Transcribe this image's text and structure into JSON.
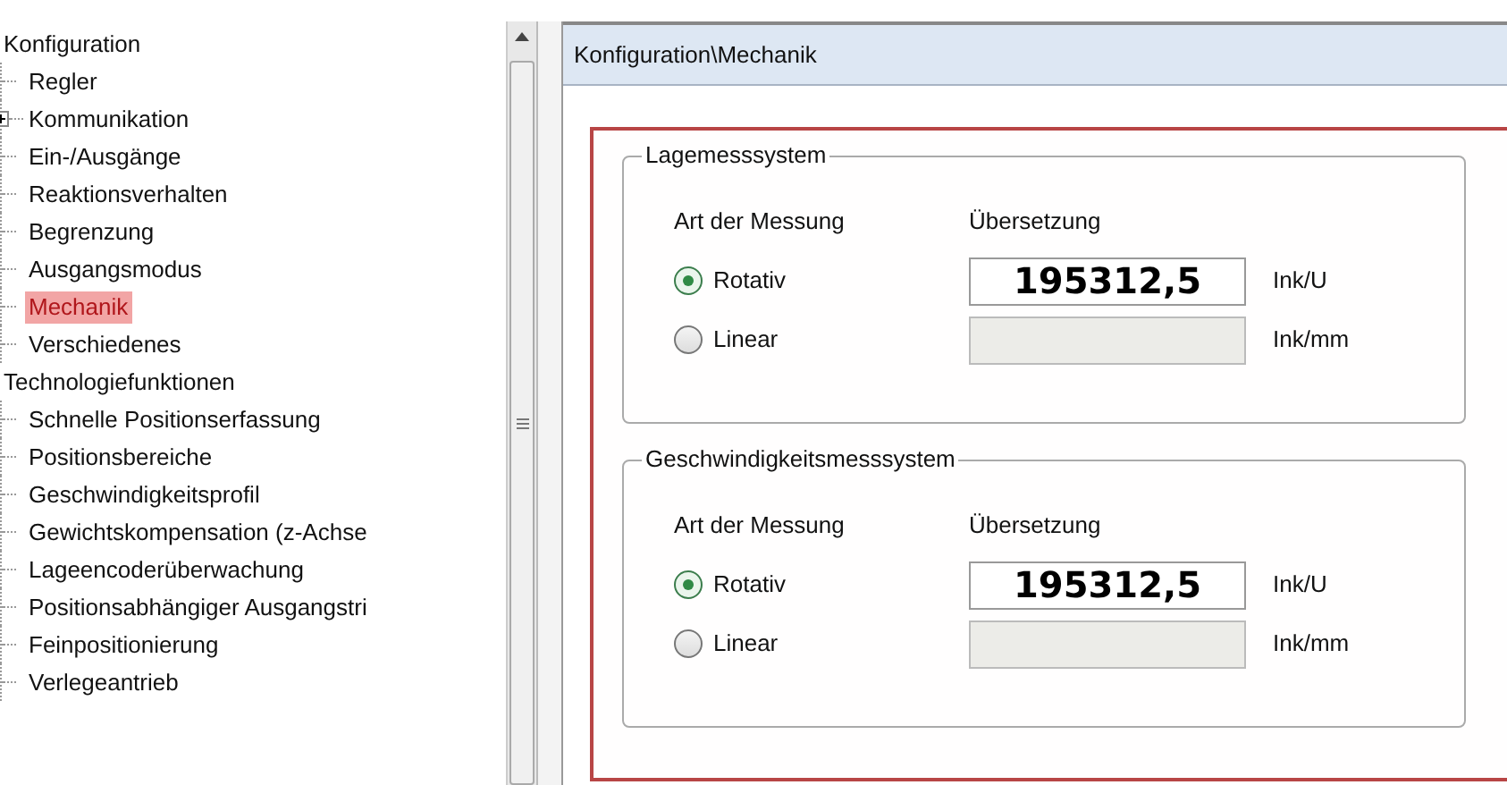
{
  "tree": [
    {
      "label": "Konfiguration",
      "selected": false,
      "children": [
        {
          "label": "Regler",
          "selected": false
        },
        {
          "label": "Kommunikation",
          "selected": false,
          "expanded": false
        },
        {
          "label": "Ein-/Ausgänge",
          "selected": false
        },
        {
          "label": "Reaktionsverhalten",
          "selected": false
        },
        {
          "label": "Begrenzung",
          "selected": false
        },
        {
          "label": "Ausgangsmodus",
          "selected": false
        },
        {
          "label": "Mechanik",
          "selected": true
        },
        {
          "label": "Verschiedenes",
          "selected": false
        }
      ]
    },
    {
      "label": "Technologiefunktionen",
      "selected": false,
      "children": [
        {
          "label": "Schnelle Positionserfassung",
          "selected": false
        },
        {
          "label": "Positionsbereiche",
          "selected": false
        },
        {
          "label": "Geschwindigkeitsprofil",
          "selected": false
        },
        {
          "label": "Gewichtskompensation (z-Achse",
          "selected": false
        },
        {
          "label": "Lageencoderüberwachung",
          "selected": false
        },
        {
          "label": "Positionsabhängiger Ausgangstri",
          "selected": false
        },
        {
          "label": "Feinpositionierung",
          "selected": false
        },
        {
          "label": "Verlegeantrieb",
          "selected": false
        }
      ]
    }
  ],
  "panel": {
    "title": "Konfiguration\\Mechanik",
    "groups": [
      {
        "title": "Lagemesssystem",
        "column_1": "Art der Messung",
        "column_2": "Übersetzung",
        "options": [
          {
            "label": "Rotativ",
            "selected": true,
            "value": "195312,5",
            "disabled": false,
            "unit": "Ink/U"
          },
          {
            "label": "Linear",
            "selected": false,
            "disabled": true,
            "unit": "Ink/mm"
          }
        ]
      },
      {
        "title": "Geschwindigkeitsmesssystem",
        "column_1": "Art der Messung",
        "column_2": "Übersetzung",
        "options": [
          {
            "label": "Rotativ",
            "selected": true,
            "value": "195312,5",
            "disabled": false,
            "unit": "Ink/U"
          },
          {
            "label": "Linear",
            "selected": false,
            "disabled": true,
            "unit": "Ink/mm"
          }
        ]
      }
    ]
  }
}
